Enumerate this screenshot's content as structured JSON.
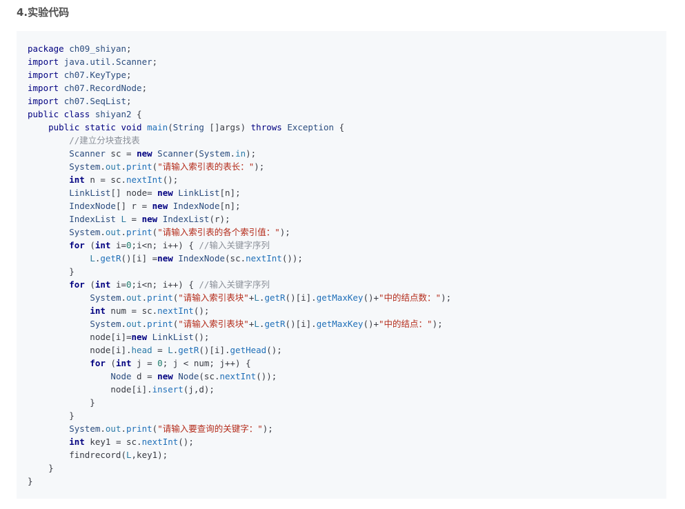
{
  "heading": "4.实验代码",
  "code": {
    "language": "java",
    "lines": [
      [
        [
          "kw",
          "package "
        ],
        [
          "type",
          "ch09_shiyan"
        ],
        [
          "plain",
          ";"
        ]
      ],
      [
        [
          "kw",
          "import "
        ],
        [
          "type",
          "java.util.Scanner"
        ],
        [
          "plain",
          ";"
        ]
      ],
      [
        [
          "kw",
          "import "
        ],
        [
          "type",
          "ch07.KeyType"
        ],
        [
          "plain",
          ";"
        ]
      ],
      [
        [
          "kw",
          "import "
        ],
        [
          "type",
          "ch07.RecordNode"
        ],
        [
          "plain",
          ";"
        ]
      ],
      [
        [
          "kw",
          "import "
        ],
        [
          "type",
          "ch07.SeqList"
        ],
        [
          "plain",
          ";"
        ]
      ],
      [
        [
          "kw",
          "public class "
        ],
        [
          "type",
          "shiyan2"
        ],
        [
          "plain",
          " {"
        ]
      ],
      [
        [
          "plain",
          "    "
        ],
        [
          "kw",
          "public static void "
        ],
        [
          "fn",
          "main"
        ],
        [
          "plain",
          "("
        ],
        [
          "type",
          "String"
        ],
        [
          "plain",
          " []args) "
        ],
        [
          "kw",
          "throws "
        ],
        [
          "type",
          "Exception"
        ],
        [
          "plain",
          " {"
        ]
      ],
      [
        [
          "plain",
          "        "
        ],
        [
          "com",
          "//建立分块查找表"
        ]
      ],
      [
        [
          "plain",
          "        "
        ],
        [
          "type",
          "Scanner"
        ],
        [
          "plain",
          " sc = "
        ],
        [
          "kwb",
          "new "
        ],
        [
          "type",
          "Scanner"
        ],
        [
          "plain",
          "("
        ],
        [
          "type",
          "System"
        ],
        [
          "plain",
          "."
        ],
        [
          "member",
          "in"
        ],
        [
          "plain",
          ");"
        ]
      ],
      [
        [
          "plain",
          "        "
        ],
        [
          "type",
          "System"
        ],
        [
          "plain",
          "."
        ],
        [
          "member",
          "out"
        ],
        [
          "plain",
          "."
        ],
        [
          "fn",
          "print"
        ],
        [
          "plain",
          "("
        ],
        [
          "str",
          "\"请输入索引表的表长：\""
        ],
        [
          "plain",
          ");"
        ]
      ],
      [
        [
          "plain",
          "        "
        ],
        [
          "kwb",
          "int"
        ],
        [
          "plain",
          " n = sc."
        ],
        [
          "fn",
          "nextInt"
        ],
        [
          "plain",
          "();"
        ]
      ],
      [
        [
          "plain",
          "        "
        ],
        [
          "type",
          "LinkList"
        ],
        [
          "plain",
          "[] node= "
        ],
        [
          "kwb",
          "new "
        ],
        [
          "type",
          "LinkList"
        ],
        [
          "plain",
          "[n];"
        ]
      ],
      [
        [
          "plain",
          "        "
        ],
        [
          "type",
          "IndexNode"
        ],
        [
          "plain",
          "[] r = "
        ],
        [
          "kwb",
          "new "
        ],
        [
          "type",
          "IndexNode"
        ],
        [
          "plain",
          "[n];"
        ]
      ],
      [
        [
          "plain",
          "        "
        ],
        [
          "type",
          "IndexList"
        ],
        [
          "plain",
          " "
        ],
        [
          "var",
          "L"
        ],
        [
          "plain",
          " = "
        ],
        [
          "kwb",
          "new "
        ],
        [
          "type",
          "IndexList"
        ],
        [
          "plain",
          "(r);"
        ]
      ],
      [
        [
          "plain",
          "        "
        ],
        [
          "type",
          "System"
        ],
        [
          "plain",
          "."
        ],
        [
          "member",
          "out"
        ],
        [
          "plain",
          "."
        ],
        [
          "fn",
          "print"
        ],
        [
          "plain",
          "("
        ],
        [
          "str",
          "\"请输入索引表的各个索引值：\""
        ],
        [
          "plain",
          ");"
        ]
      ],
      [
        [
          "plain",
          "        "
        ],
        [
          "kwb",
          "for"
        ],
        [
          "plain",
          " ("
        ],
        [
          "kwb",
          "int"
        ],
        [
          "plain",
          " i="
        ],
        [
          "num",
          "0"
        ],
        [
          "plain",
          ";i<n; i++) { "
        ],
        [
          "com",
          "//输入关键字序列"
        ]
      ],
      [
        [
          "plain",
          "            "
        ],
        [
          "var",
          "L"
        ],
        [
          "plain",
          "."
        ],
        [
          "fn",
          "getR"
        ],
        [
          "plain",
          "()[i] ="
        ],
        [
          "kwb",
          "new "
        ],
        [
          "type",
          "IndexNode"
        ],
        [
          "plain",
          "(sc."
        ],
        [
          "fn",
          "nextInt"
        ],
        [
          "plain",
          "());"
        ]
      ],
      [
        [
          "plain",
          "        }"
        ]
      ],
      [
        [
          "plain",
          "        "
        ],
        [
          "kwb",
          "for"
        ],
        [
          "plain",
          " ("
        ],
        [
          "kwb",
          "int"
        ],
        [
          "plain",
          " i="
        ],
        [
          "num",
          "0"
        ],
        [
          "plain",
          ";i<n; i++) { "
        ],
        [
          "com",
          "//输入关键字序列"
        ]
      ],
      [
        [
          "plain",
          "            "
        ],
        [
          "type",
          "System"
        ],
        [
          "plain",
          "."
        ],
        [
          "member",
          "out"
        ],
        [
          "plain",
          "."
        ],
        [
          "fn",
          "print"
        ],
        [
          "plain",
          "("
        ],
        [
          "str",
          "\"请输入索引表块\""
        ],
        [
          "plain",
          "+"
        ],
        [
          "var",
          "L"
        ],
        [
          "plain",
          "."
        ],
        [
          "fn",
          "getR"
        ],
        [
          "plain",
          "()[i]."
        ],
        [
          "fn",
          "getMaxKey"
        ],
        [
          "plain",
          "()+"
        ],
        [
          "str",
          "\"中的结点数：\""
        ],
        [
          "plain",
          ");"
        ]
      ],
      [
        [
          "plain",
          "            "
        ],
        [
          "kwb",
          "int"
        ],
        [
          "plain",
          " num = sc."
        ],
        [
          "fn",
          "nextInt"
        ],
        [
          "plain",
          "();"
        ]
      ],
      [
        [
          "plain",
          "            "
        ],
        [
          "type",
          "System"
        ],
        [
          "plain",
          "."
        ],
        [
          "member",
          "out"
        ],
        [
          "plain",
          "."
        ],
        [
          "fn",
          "print"
        ],
        [
          "plain",
          "("
        ],
        [
          "str",
          "\"请输入索引表块\""
        ],
        [
          "plain",
          "+"
        ],
        [
          "var",
          "L"
        ],
        [
          "plain",
          "."
        ],
        [
          "fn",
          "getR"
        ],
        [
          "plain",
          "()[i]."
        ],
        [
          "fn",
          "getMaxKey"
        ],
        [
          "plain",
          "()+"
        ],
        [
          "str",
          "\"中的结点：\""
        ],
        [
          "plain",
          ");"
        ]
      ],
      [
        [
          "plain",
          "            node[i]="
        ],
        [
          "kwb",
          "new "
        ],
        [
          "type",
          "LinkList"
        ],
        [
          "plain",
          "();"
        ]
      ],
      [
        [
          "plain",
          "            node[i]."
        ],
        [
          "member",
          "head"
        ],
        [
          "plain",
          " = "
        ],
        [
          "var",
          "L"
        ],
        [
          "plain",
          "."
        ],
        [
          "fn",
          "getR"
        ],
        [
          "plain",
          "()[i]."
        ],
        [
          "fn",
          "getHead"
        ],
        [
          "plain",
          "();"
        ]
      ],
      [
        [
          "plain",
          "            "
        ],
        [
          "kwb",
          "for"
        ],
        [
          "plain",
          " ("
        ],
        [
          "kwb",
          "int"
        ],
        [
          "plain",
          " j = "
        ],
        [
          "num",
          "0"
        ],
        [
          "plain",
          "; j < num; j++) {"
        ]
      ],
      [
        [
          "plain",
          "                "
        ],
        [
          "type",
          "Node"
        ],
        [
          "plain",
          " d = "
        ],
        [
          "kwb",
          "new "
        ],
        [
          "type",
          "Node"
        ],
        [
          "plain",
          "(sc."
        ],
        [
          "fn",
          "nextInt"
        ],
        [
          "plain",
          "());"
        ]
      ],
      [
        [
          "plain",
          "                node[i]."
        ],
        [
          "fn",
          "insert"
        ],
        [
          "plain",
          "(j,d);"
        ]
      ],
      [
        [
          "plain",
          "            }"
        ]
      ],
      [
        [
          "plain",
          "        }"
        ]
      ],
      [
        [
          "plain",
          "        "
        ],
        [
          "type",
          "System"
        ],
        [
          "plain",
          "."
        ],
        [
          "member",
          "out"
        ],
        [
          "plain",
          "."
        ],
        [
          "fn",
          "print"
        ],
        [
          "plain",
          "("
        ],
        [
          "str",
          "\"请输入要查询的关键字：\""
        ],
        [
          "plain",
          ");"
        ]
      ],
      [
        [
          "plain",
          "        "
        ],
        [
          "kwb",
          "int"
        ],
        [
          "plain",
          " key1 = sc."
        ],
        [
          "fn",
          "nextInt"
        ],
        [
          "plain",
          "();"
        ]
      ],
      [
        [
          "plain",
          "        findrecord("
        ],
        [
          "var",
          "L"
        ],
        [
          "plain",
          ",key1);"
        ]
      ],
      [
        [
          "plain",
          "    }"
        ]
      ],
      [
        [
          "plain",
          "}"
        ]
      ]
    ]
  }
}
